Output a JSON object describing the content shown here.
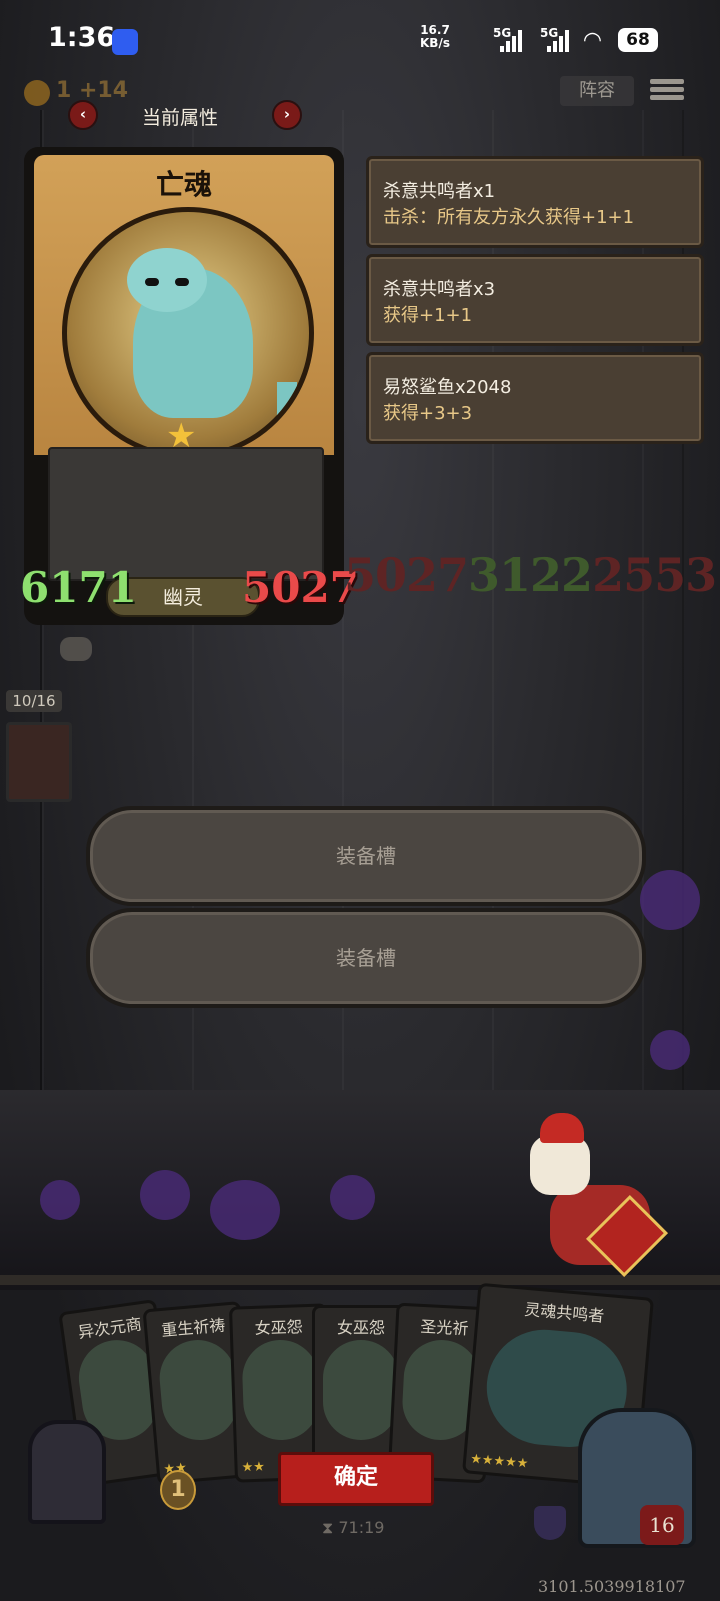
{
  "status_bar": {
    "time": "1:36",
    "net_speed": "16.7",
    "net_unit": "KB/s",
    "sig1": "5G",
    "sig2": "5G",
    "battery": "68"
  },
  "hud": {
    "coins": "1 +14",
    "lineup_label": "阵容"
  },
  "attributes": {
    "title": "当前属性",
    "prev": "‹",
    "next": "›"
  },
  "card": {
    "name": "亡魂",
    "attack": "6171",
    "health": "5027",
    "type": "幽灵",
    "star": "★"
  },
  "effects": [
    {
      "title": "杀意共鸣者x1",
      "desc": "击杀：所有友方永久获得+1+1"
    },
    {
      "title": "杀意共鸣者x3",
      "desc": "获得+1+1"
    },
    {
      "title": "易怒鲨鱼x2048",
      "desc": "获得+3+3"
    }
  ],
  "board_numbers": {
    "n1": "5027",
    "n2": "3122",
    "n3": "2553"
  },
  "side": {
    "counter": "10/16"
  },
  "equipment": {
    "slot1": "装备槽",
    "slot2": "装备槽"
  },
  "hand": [
    {
      "name": "异次元商"
    },
    {
      "name": "重生祈祷"
    },
    {
      "name": "女巫怨"
    },
    {
      "name": "女巫怨"
    },
    {
      "name": "圣光祈"
    },
    {
      "name": "灵魂共鸣者"
    }
  ],
  "bottom": {
    "confirm": "确定",
    "timer": "71:19",
    "gold_count": "1",
    "hero_level": "16",
    "score": "3101.5039918107"
  },
  "colors": {
    "attack": "#8ee06f",
    "health": "#ea4a4a",
    "confirm": "#b71f1c",
    "effect_desc": "#e8c888"
  }
}
